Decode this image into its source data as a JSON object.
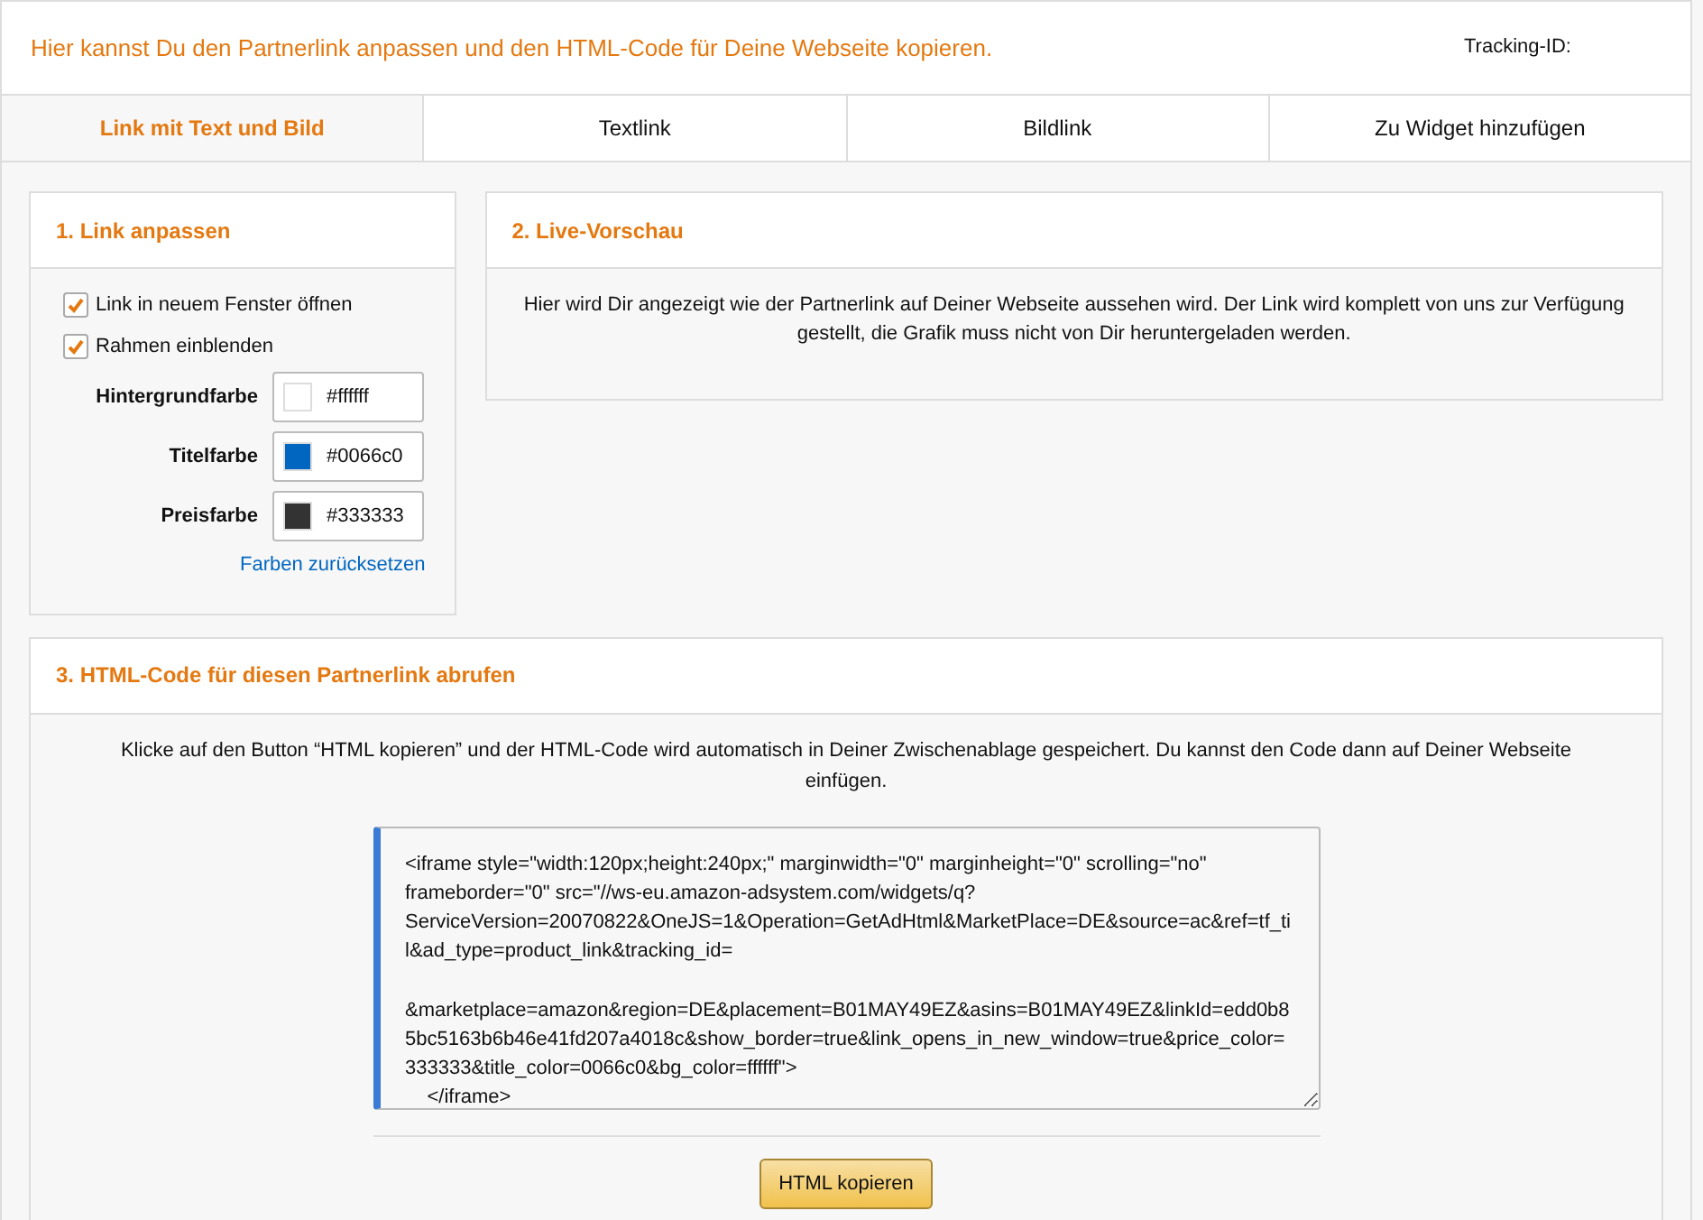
{
  "header": {
    "title": "Hier kannst Du den Partnerlink anpassen und den HTML-Code für Deine Webseite kopieren.",
    "tracking_label": "Tracking-ID:"
  },
  "tabs": [
    {
      "label": "Link mit Text und Bild",
      "selected": true
    },
    {
      "label": "Textlink",
      "selected": false
    },
    {
      "label": "Bildlink",
      "selected": false
    },
    {
      "label": "Zu Widget hinzufügen",
      "selected": false
    }
  ],
  "customize": {
    "title": "1. Link anpassen",
    "options": [
      {
        "label": "Link in neuem Fenster öffnen",
        "checked": true
      },
      {
        "label": "Rahmen einblenden",
        "checked": true
      }
    ],
    "colors": [
      {
        "label": "Hintergrundfarbe",
        "value": "#ffffff",
        "color": "#ffffff"
      },
      {
        "label": "Titelfarbe",
        "value": "#0066c0",
        "color": "#0066c0"
      },
      {
        "label": "Preisfarbe",
        "value": "#333333",
        "color": "#333333"
      }
    ],
    "reset_link": "Farben zurücksetzen"
  },
  "preview": {
    "title": "2. Live-Vorschau",
    "text": "Hier wird Dir angezeigt wie der Partnerlink auf Deiner Webseite aussehen wird. Der Link wird komplett von uns zur Verfügung gestellt, die Grafik muss nicht von Dir heruntergeladen werden."
  },
  "code_section": {
    "title": "3. HTML-Code für diesen Partnerlink abrufen",
    "text": "Klicke auf den Button “HTML kopieren” und der HTML-Code wird automatisch in Deiner Zwischenablage gespeichert. Du kannst den Code dann auf Deiner Webseite einfügen.",
    "code": "<iframe style=\"width:120px;height:240px;\" marginwidth=\"0\" marginheight=\"0\" scrolling=\"no\" frameborder=\"0\" src=\"//ws-eu.amazon-adsystem.com/widgets/q?ServiceVersion=20070822&OneJS=1&Operation=GetAdHtml&MarketPlace=DE&source=ac&ref=tf_til&ad_type=product_link&tracking_id=\n    &marketplace=amazon&region=DE&placement=B01MAY49EZ&asins=B01MAY49EZ&linkId=edd0b85bc5163b6b46e41fd207a4018c&show_border=true&link_opens_in_new_window=true&price_color=333333&title_color=0066c0&bg_color=ffffff\">\n    </iframe>",
    "button": "HTML kopieren"
  }
}
